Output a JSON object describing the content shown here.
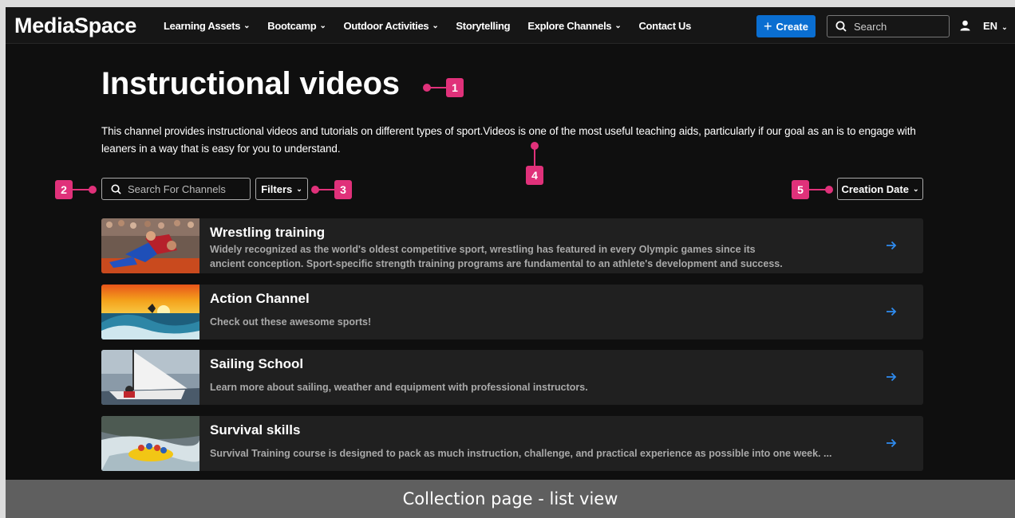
{
  "nav": {
    "logo": "MediaSpace",
    "menu": [
      {
        "label": "Learning Assets",
        "has_dropdown": true
      },
      {
        "label": "Bootcamp",
        "has_dropdown": true
      },
      {
        "label": "Outdoor Activities",
        "has_dropdown": true
      },
      {
        "label": "Storytelling",
        "has_dropdown": false
      },
      {
        "label": "Explore Channels",
        "has_dropdown": true
      },
      {
        "label": "Contact Us",
        "has_dropdown": false
      }
    ],
    "create_label": "Create",
    "search_placeholder": "Search",
    "language": "EN",
    "accent_color": "#0a6ed1"
  },
  "page": {
    "title": "Instructional videos",
    "description": "This channel provides instructional videos and tutorials on different types of sport.Videos is one of the most useful teaching aids, particularly if our goal as an is to engage with leaners in a way that is easy for you to understand."
  },
  "controls": {
    "channel_search_placeholder": "Search For Channels",
    "filters_label": "Filters",
    "sort_label": "Creation Date"
  },
  "annotations": {
    "color": "#e0317a",
    "labels": [
      "1",
      "2",
      "3",
      "4",
      "5"
    ]
  },
  "channels": [
    {
      "title": "Wrestling training",
      "description": "Widely recognized as the world's oldest competitive sport, wrestling has featured in every Olympic games since its ancient conception. Sport-specific strength training programs are fundamental to an athlete's development and success.",
      "thumbnail": "wrestling-thumbnail"
    },
    {
      "title": "Action Channel",
      "description": "Check out these awesome sports!",
      "thumbnail": "surfing-sunset-thumbnail"
    },
    {
      "title": "Sailing School",
      "description": "Learn more about sailing, weather and equipment with professional instructors.",
      "thumbnail": "sailboat-thumbnail"
    },
    {
      "title": "Survival skills",
      "description": "Survival Training course is designed to pack as much instruction, challenge, and practical experience as possible into one week. ...",
      "thumbnail": "rafting-thumbnail"
    }
  ],
  "caption": "Collection page - list view"
}
